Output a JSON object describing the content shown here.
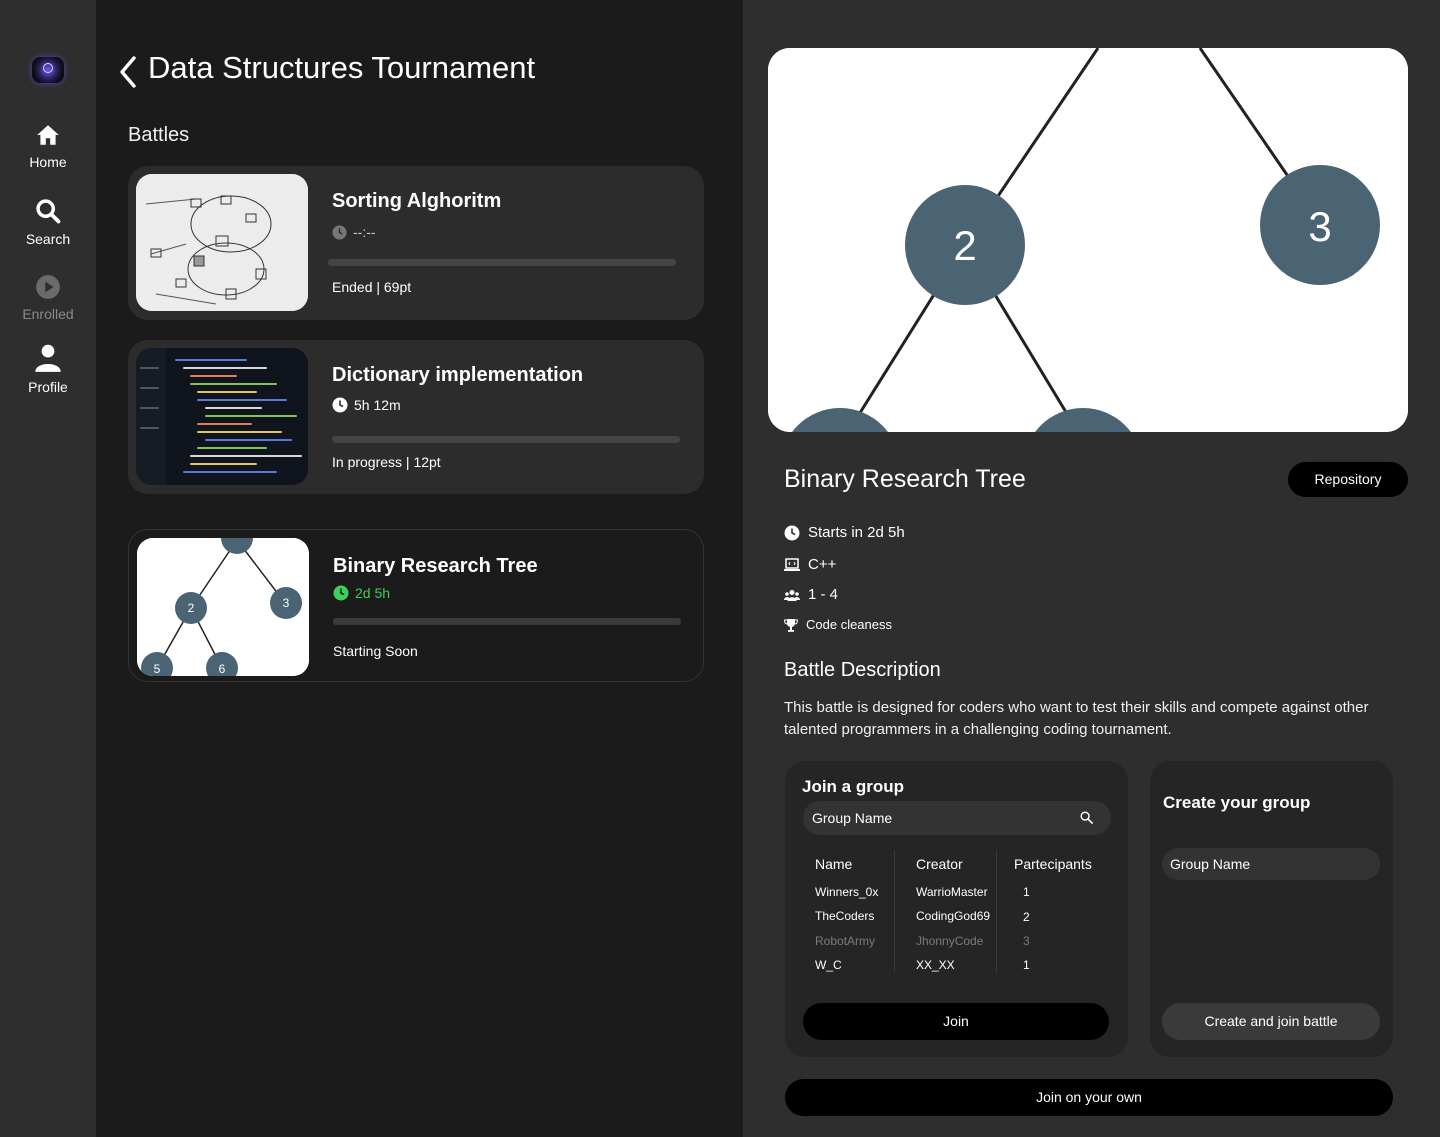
{
  "sidebar": {
    "items": [
      {
        "label": "Home",
        "icon": "home-icon"
      },
      {
        "label": "Search",
        "icon": "search-icon"
      },
      {
        "label": "Enrolled",
        "icon": "play-icon"
      },
      {
        "label": "Profile",
        "icon": "person-icon"
      }
    ]
  },
  "header": {
    "title": "Data Structures Tournament"
  },
  "battles": {
    "label": "Battles",
    "cards": [
      {
        "title": "Sorting Alghoritm",
        "time": "--:--",
        "status": "Ended | 69pt"
      },
      {
        "title": "Dictionary implementation",
        "time": "5h 12m",
        "status": "In progress | 12pt"
      },
      {
        "title": "Binary Research Tree",
        "time": "2d 5h",
        "status": "Starting Soon",
        "time_color": "#3ad05a"
      }
    ]
  },
  "detail": {
    "title": "Binary Research Tree",
    "repository_label": "Repository",
    "starts": "Starts in 2d 5h",
    "language": "C++",
    "group_size": "1 - 4",
    "criteria": "Code cleaness",
    "description_title": "Battle Description",
    "description": "This battle is designed for coders who want to test their skills and compete against other talented programmers in a challenging coding tournament."
  },
  "join_group": {
    "title": "Join a group",
    "search_placeholder": "Group Name",
    "columns": [
      "Name",
      "Creator",
      "Partecipants"
    ],
    "rows": [
      [
        "Winners_0x",
        "WarrioMaster",
        "1"
      ],
      [
        "TheCoders",
        "CodingGod69",
        "2"
      ],
      [
        "RobotArmy",
        "JhonnyCode",
        "3"
      ],
      [
        "W_C",
        "XX_XX",
        "1"
      ]
    ],
    "join_label": "Join"
  },
  "create_group": {
    "title": "Create your group",
    "input_placeholder": "Group Name",
    "button_label": "Create and join battle"
  },
  "join_alone_label": "Join on your own",
  "tree_nodes": {
    "hero": [
      "2",
      "3"
    ],
    "thumb": [
      "2",
      "3",
      "5",
      "6"
    ]
  },
  "colors": {
    "node": "#4b6474",
    "accent_green": "#3ad05a",
    "background": "#1b1b1b",
    "panel": "#2e2e2e"
  }
}
